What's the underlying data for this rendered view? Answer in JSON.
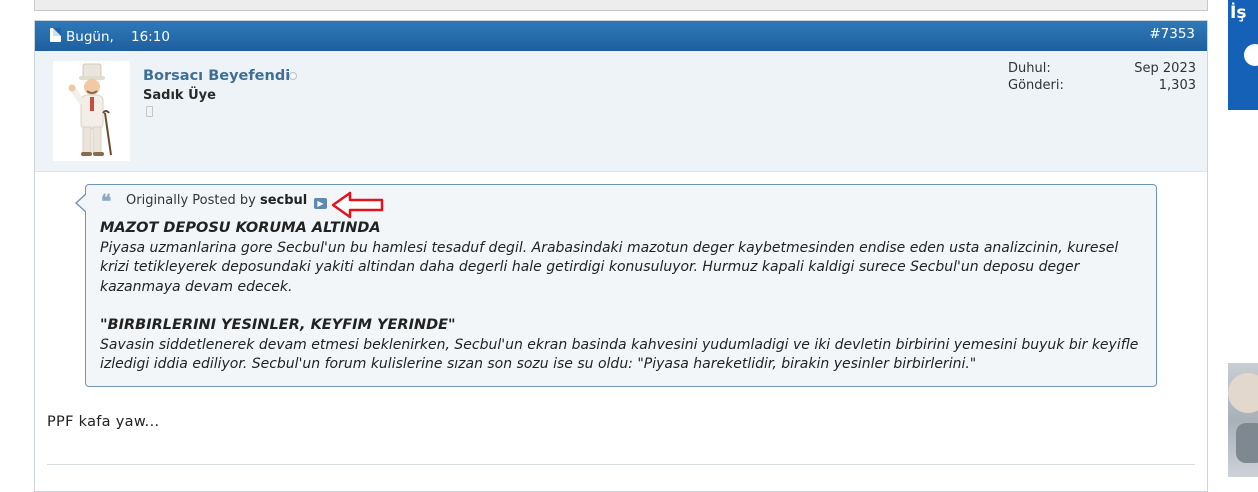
{
  "post": {
    "date": "Bugün,",
    "time": "16:10",
    "number": "#7353"
  },
  "user": {
    "name": "Borsacı Beyefendi",
    "title": "Sadık Üye",
    "join_label": "Duhul:",
    "join_value": "Sep 2023",
    "posts_label": "Gönderi:",
    "posts_value": "1,303"
  },
  "quote": {
    "prefix": "Originally Posted by",
    "author": "secbul",
    "title1": "MAZOT DEPOSU KORUMA ALTINDA",
    "body1": "Piyasa uzmanlarina gore Secbul'un bu hamlesi tesaduf degil. Arabasindaki mazotun deger kaybetmesinden endise eden usta analizcinin, kuresel krizi tetikleyerek deposundaki yakiti altindan daha degerli hale getirdigi konusuluyor. Hurmuz kapali kaldigi surece Secbul'un deposu deger kazanmaya devam edecek.",
    "title2": "\"BIRBIRLERINI YESINLER, KEYFIM YERINDE\"",
    "body2": "Savasin siddetlenerek devam etmesi beklenirken, Secbul'un ekran basinda kahvesini yudumladigi ve iki devletin birbirini yemesini buyuk bir keyifle izledigi iddia ediliyor. Secbul'un forum kulislerine sızan son sozu ise su oldu: \"Piyasa hareketlidir, birakin yesinler birbirlerini.\""
  },
  "message": "PPF kafa yaw...",
  "ad": {
    "text": "İş"
  },
  "colors": {
    "header_blue": "#2f79b9",
    "username": "#3f6f97",
    "quote_border": "#6f93b5",
    "annotation_arrow": "#e0141e"
  },
  "icons": {
    "post": "document-icon",
    "online": "status-dot-icon",
    "mobile": "phone-icon",
    "quote": "quote-icon",
    "goto": "goto-post-icon"
  }
}
